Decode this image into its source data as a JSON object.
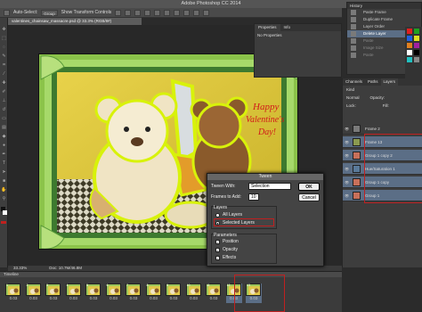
{
  "app": {
    "title": "Adobe Photoshop CC 2014"
  },
  "options_bar": {
    "auto_select": "Auto-Select:",
    "auto_select_value": "Group",
    "transform": "Show Transform Controls"
  },
  "document": {
    "tab": "valentines_chainsaw_massacre.psd @ 33.3% (RGB/8#)",
    "zoom": "33.33%",
    "doc_size": "Doc: 10.7M/46.8M",
    "canvas_text": [
      "Happy",
      "Valentine's",
      "Day!"
    ]
  },
  "properties": {
    "tabs": [
      "Properties",
      "Info"
    ],
    "content": "No Properties"
  },
  "history": {
    "title": "History",
    "items": [
      "Paste Frame",
      "Duplicate Frame",
      "Layer Order",
      "Delete Layer",
      "Paste",
      "Image Size",
      "Paste"
    ]
  },
  "layers": {
    "tabs": [
      "Channels",
      "Paths",
      "Layers"
    ],
    "kind": "Kind",
    "blend": "Normal",
    "opacity_label": "Opacity:",
    "lock": "Lock:",
    "fill_label": "Fill:",
    "items": [
      "Frame 2",
      "Frame 13",
      "Group 1 copy 2",
      "Hue/Saturation 1",
      "Group 1 copy",
      "Group 1"
    ]
  },
  "timeline": {
    "title": "Timeline",
    "frame_numbers": [
      "1",
      "2",
      "3",
      "4",
      "5",
      "6",
      "7",
      "8",
      "9",
      "10",
      "11",
      "12",
      "13"
    ],
    "delays": [
      "0.03",
      "0.03",
      "0.03",
      "0.03",
      "0.03",
      "0.03",
      "0.03",
      "0.03",
      "0.03",
      "0.03",
      "0.03",
      "0.03",
      "0.03"
    ]
  },
  "dialog": {
    "title": "Tween",
    "tween_with_label": "Tween With:",
    "tween_with_value": "Selection",
    "frames_to_add_label": "Frames to Add:",
    "frames_to_add_value": "10",
    "ok": "OK",
    "cancel": "Cancel",
    "layers_group": "Layers",
    "all_layers": "All Layers",
    "selected_layers": "Selected Layers",
    "params_group": "Parameters",
    "position": "Position",
    "opacity": "Opacity",
    "effects": "Effects"
  },
  "colors": {
    "accent_selection": "#5b6e86",
    "highlight_red": "#c02020",
    "lime_outline": "#d8f20a"
  }
}
